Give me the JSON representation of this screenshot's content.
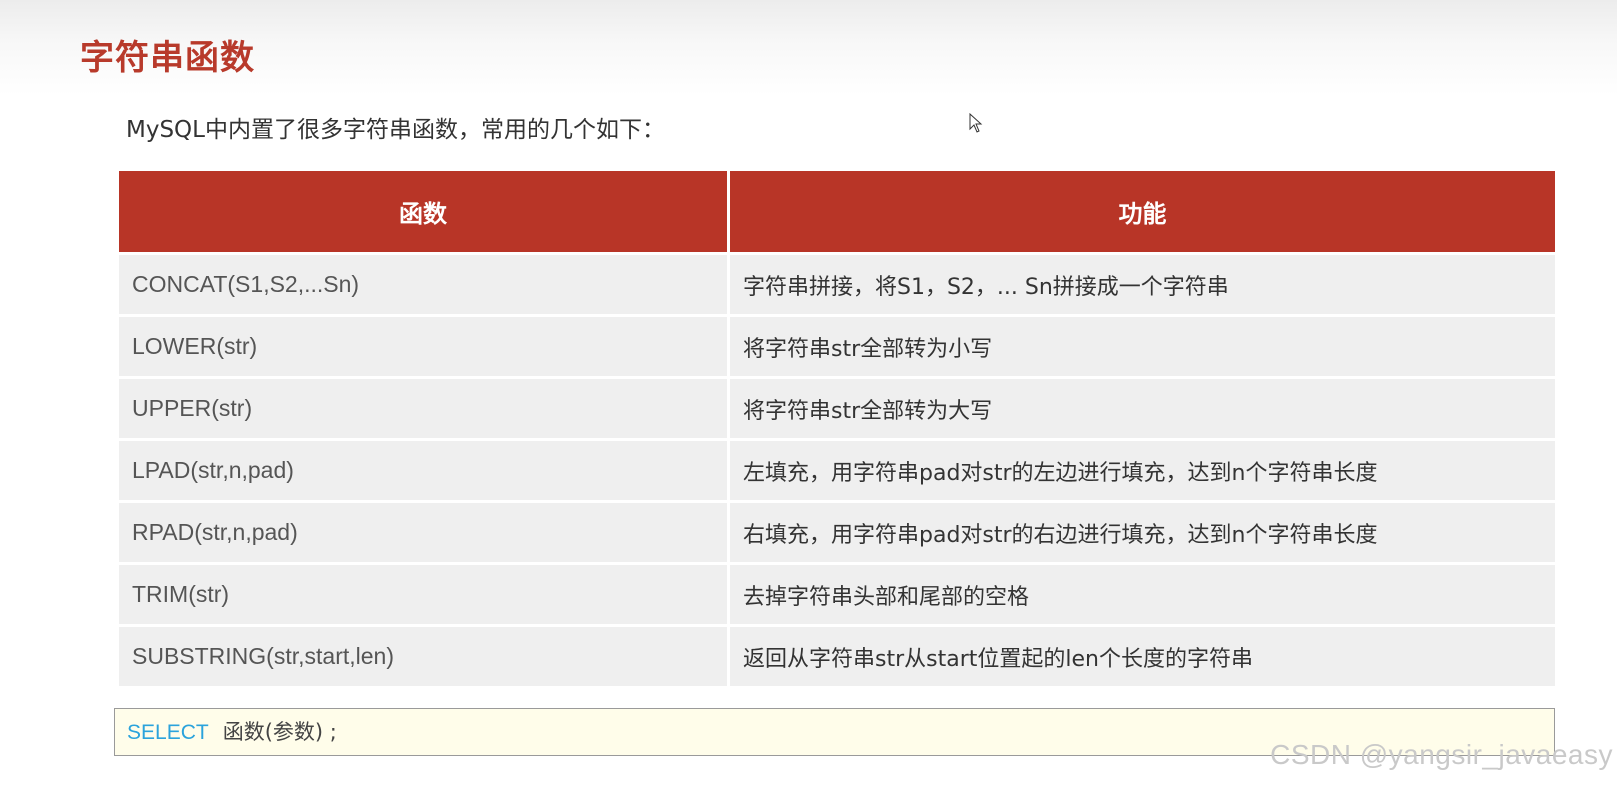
{
  "title": "字符串函数",
  "intro": "MySQL中内置了很多字符串函数，常用的几个如下：",
  "table": {
    "headers": [
      "函数",
      "功能"
    ],
    "rows": [
      {
        "func": "CONCAT(S1,S2,...Sn)",
        "desc": "字符串拼接，将S1，S2，... Sn拼接成一个字符串"
      },
      {
        "func": "LOWER(str)",
        "desc": "将字符串str全部转为小写"
      },
      {
        "func": "UPPER(str)",
        "desc": "将字符串str全部转为大写"
      },
      {
        "func": "LPAD(str,n,pad)",
        "desc": "左填充，用字符串pad对str的左边进行填充，达到n个字符串长度"
      },
      {
        "func": "RPAD(str,n,pad)",
        "desc": "右填充，用字符串pad对str的右边进行填充，达到n个字符串长度"
      },
      {
        "func": "TRIM(str)",
        "desc": "去掉字符串头部和尾部的空格"
      },
      {
        "func": "SUBSTRING(str,start,len)",
        "desc": "返回从字符串str从start位置起的len个长度的字符串"
      }
    ]
  },
  "code": {
    "keyword": "SELECT",
    "rest": "函数(参数) ;"
  },
  "watermark": "CSDN @yangsir_javaeasy",
  "colors": {
    "accent": "#b83527",
    "title": "#b83a2b",
    "keyword": "#2ba3dc",
    "code_bg": "#fffdea"
  },
  "icons": [
    "mouse-cursor-icon"
  ]
}
